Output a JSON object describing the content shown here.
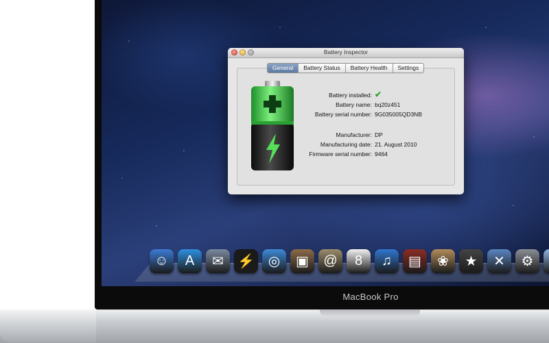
{
  "window": {
    "title": "Battery Inspector",
    "tabs": [
      {
        "label": "General",
        "active": true
      },
      {
        "label": "Battery Status",
        "active": false
      },
      {
        "label": "Battery Health",
        "active": false
      },
      {
        "label": "Settings",
        "active": false
      }
    ]
  },
  "general": {
    "battery_installed_label": "Battery installed:",
    "battery_installed_value": "✔",
    "battery_name_label": "Battery name:",
    "battery_name_value": "bq20z451",
    "serial_label": "Battery serial number:",
    "serial_value": "9G035005QD3NB",
    "manufacturer_label": "Manufacturer:",
    "manufacturer_value": "DP",
    "mfg_date_label": "Manufacturing date:",
    "mfg_date_value": "21. August 2010",
    "firmware_label": "Firmware serial number:",
    "firmware_value": "9464"
  },
  "device": {
    "brand": "MacBook Pro"
  },
  "dock": {
    "items": [
      {
        "name": "finder-icon",
        "glyph": "☺",
        "color": "#3b7bd6"
      },
      {
        "name": "app-store-icon",
        "glyph": "A",
        "color": "#2e8fe0"
      },
      {
        "name": "mail-icon",
        "glyph": "✉",
        "color": "#7a8aa0"
      },
      {
        "name": "battery-inspector-icon",
        "glyph": "⚡",
        "color": "#1a1a1a"
      },
      {
        "name": "safari-icon",
        "glyph": "◎",
        "color": "#3d8ad8"
      },
      {
        "name": "photo-booth-icon",
        "glyph": "▣",
        "color": "#8b6b4a"
      },
      {
        "name": "address-book-icon",
        "glyph": "@",
        "color": "#9d8c6b"
      },
      {
        "name": "ical-icon",
        "glyph": "8",
        "color": "#f2f2f2"
      },
      {
        "name": "itunes-icon",
        "glyph": "♫",
        "color": "#2f77d1"
      },
      {
        "name": "photo-book-icon",
        "glyph": "▤",
        "color": "#8a2d25"
      },
      {
        "name": "iphoto-icon",
        "glyph": "❀",
        "color": "#b28c5a"
      },
      {
        "name": "imovie-icon",
        "glyph": "★",
        "color": "#444444"
      },
      {
        "name": "xcode-icon",
        "glyph": "✕",
        "color": "#5b86c2"
      },
      {
        "name": "system-preferences-icon",
        "glyph": "⚙",
        "color": "#8a8f96"
      },
      {
        "name": "applications-folder-icon",
        "glyph": "▭",
        "color": "#8fb4e0"
      }
    ]
  },
  "colors": {
    "accent": "#5d7aa3",
    "battery_green": "#3ec24a",
    "check_green": "#2ea42e"
  }
}
